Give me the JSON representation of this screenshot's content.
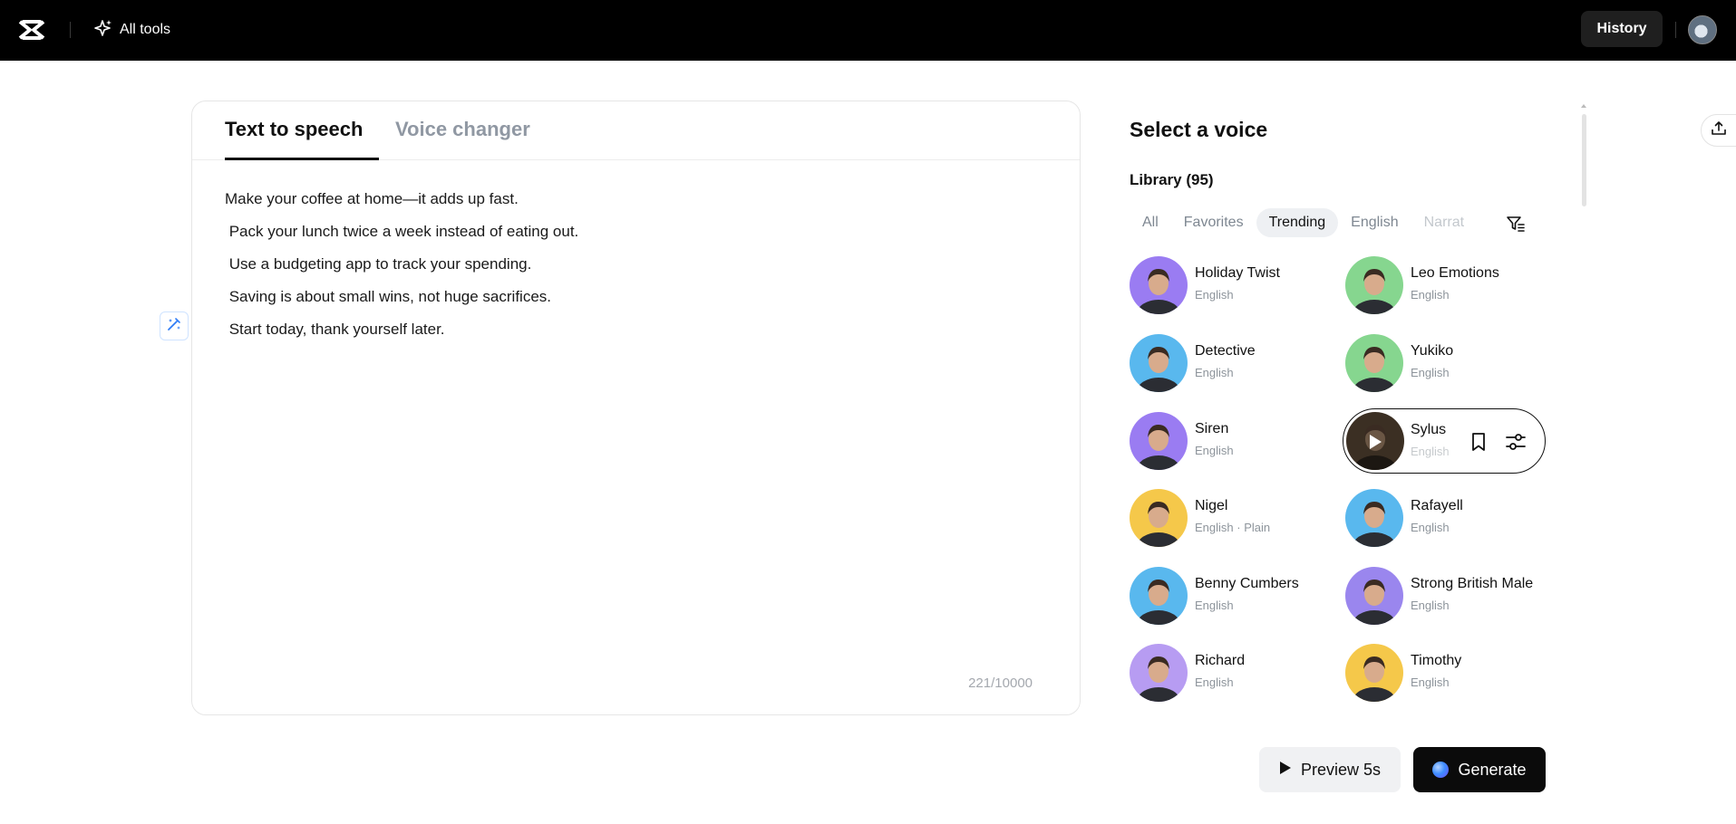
{
  "topbar": {
    "all_tools_label": "All tools",
    "history_label": "History"
  },
  "editor": {
    "tabs": [
      {
        "label": "Text to speech",
        "active": true
      },
      {
        "label": "Voice changer",
        "active": false
      }
    ],
    "lines": [
      "Make your coffee at home—it adds up fast.",
      " Pack your lunch twice a week instead of eating out.",
      " Use a budgeting app to track your spending.",
      " Saving is about small wins, not huge sacrifices.",
      " Start today, thank yourself later."
    ],
    "char_count": "221/10000"
  },
  "voice_panel": {
    "title": "Select a voice",
    "library_label": "Library (95)",
    "filters": [
      {
        "label": "All",
        "selected": false
      },
      {
        "label": "Favorites",
        "selected": false
      },
      {
        "label": "Trending",
        "selected": true
      },
      {
        "label": "English",
        "selected": false
      },
      {
        "label": "Narrat",
        "selected": false
      }
    ],
    "voices": [
      {
        "name": "Holiday Twist",
        "lang": "English",
        "bg": "#9a7cf2"
      },
      {
        "name": "Leo Emotions",
        "lang": "English",
        "bg": "#86d68f"
      },
      {
        "name": "Detective",
        "lang": "English",
        "bg": "#59b8ee"
      },
      {
        "name": "Yukiko",
        "lang": "English",
        "bg": "#86d68f"
      },
      {
        "name": "Siren",
        "lang": "English",
        "bg": "#9a7cf2"
      },
      {
        "name": "Sylus",
        "lang": "English",
        "bg": "#3b2f23"
      },
      {
        "name": "Nigel",
        "lang": "English · Plain",
        "bg": "#f5c84a"
      },
      {
        "name": "Rafayell",
        "lang": "English",
        "bg": "#59b8ee"
      },
      {
        "name": "Benny Cumbers",
        "lang": "English",
        "bg": "#59b8ee"
      },
      {
        "name": "Strong British Male",
        "lang": "English",
        "bg": "#9a86ee"
      },
      {
        "name": "Richard",
        "lang": "English",
        "bg": "#b79cf2"
      },
      {
        "name": "Timothy",
        "lang": "English",
        "bg": "#f5c84a"
      }
    ]
  },
  "actions": {
    "preview_label": "Preview 5s",
    "generate_label": "Generate"
  }
}
